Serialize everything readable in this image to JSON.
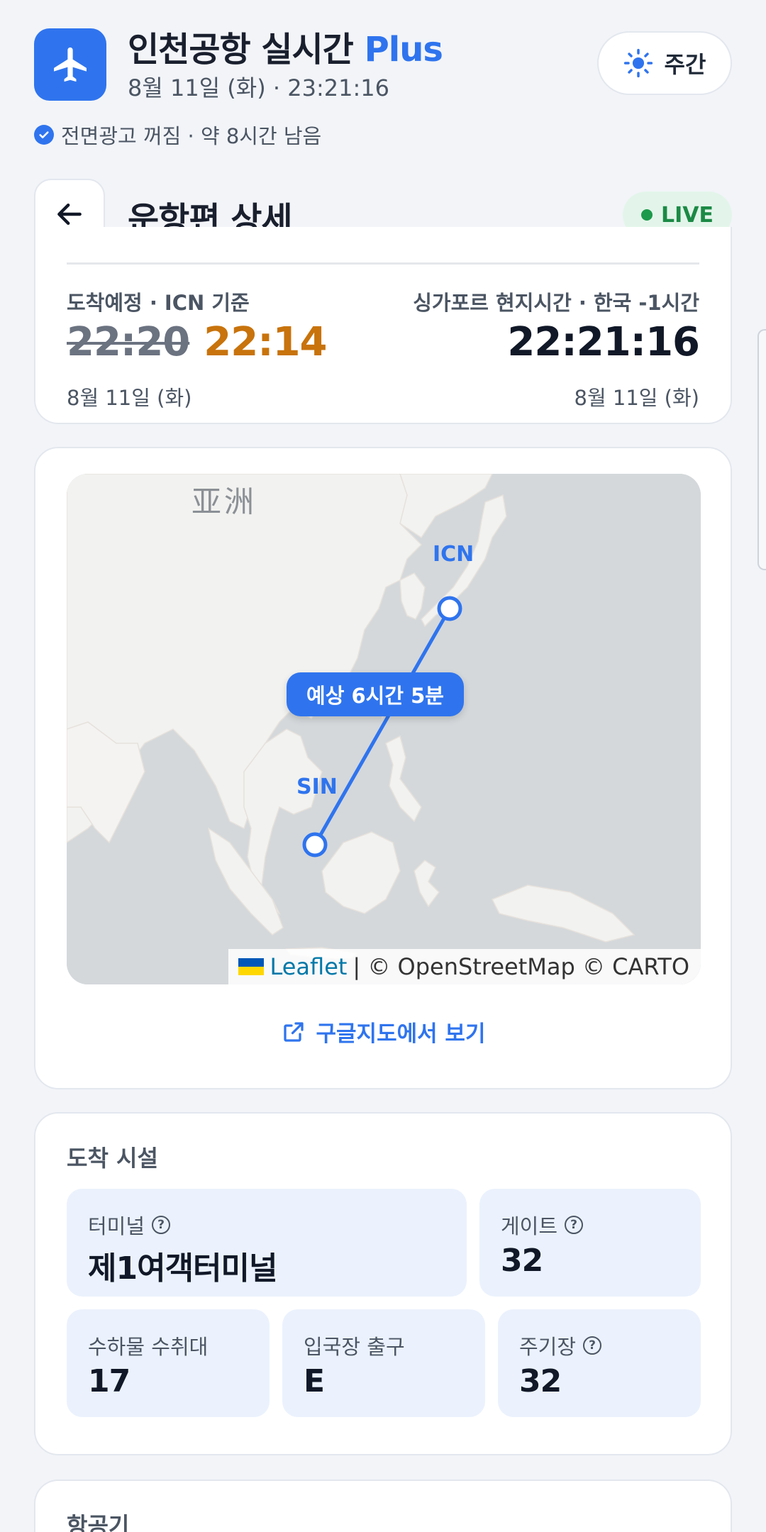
{
  "app": {
    "title": "인천공항 실시간",
    "title_badge": "Plus",
    "subtitle": "8월 11일 (화) · 23:21:16",
    "mode_label": "주간",
    "ad_status": "전면광고 꺼짐 · 약 8시간 남음",
    "accent_color": "#2f74ee"
  },
  "detail": {
    "title": "운항편 상세",
    "live_label": "LIVE"
  },
  "arrival": {
    "label": "도착예정 · ICN 기준",
    "scheduled_time": "22:20",
    "estimated_time": "22:14",
    "date": "8월 11일 (화)",
    "local_label": "싱가포르 현지시간 · 한국 -1시간",
    "local_time": "22:21:16",
    "local_date": "8월 11일 (화)"
  },
  "map": {
    "region_label": "亚洲",
    "origin_code": "ICN",
    "destination_code": "SIN",
    "duration_label": "예상 6시간 5분",
    "attribution_leaflet": "Leaflet",
    "attribution_rest": "| © OpenStreetMap © CARTO",
    "google_maps_link": "구글지도에서 보기"
  },
  "facilities": {
    "title": "도착 시설",
    "tiles": [
      {
        "label": "터미널",
        "value": "제1여객터미널"
      },
      {
        "label": "게이트",
        "value": "32"
      },
      {
        "label": "수하물 수취대",
        "value": "17"
      },
      {
        "label": "입국장 출구",
        "value": "E"
      },
      {
        "label": "주기장",
        "value": "32"
      }
    ]
  },
  "aircraft": {
    "title": "항공기"
  },
  "icons": {
    "logo": "airplane-icon",
    "mode": "sun-icon",
    "back": "arrow-left-icon",
    "external": "external-link-icon",
    "help": "question-circle-icon",
    "check": "check-circle-icon"
  }
}
